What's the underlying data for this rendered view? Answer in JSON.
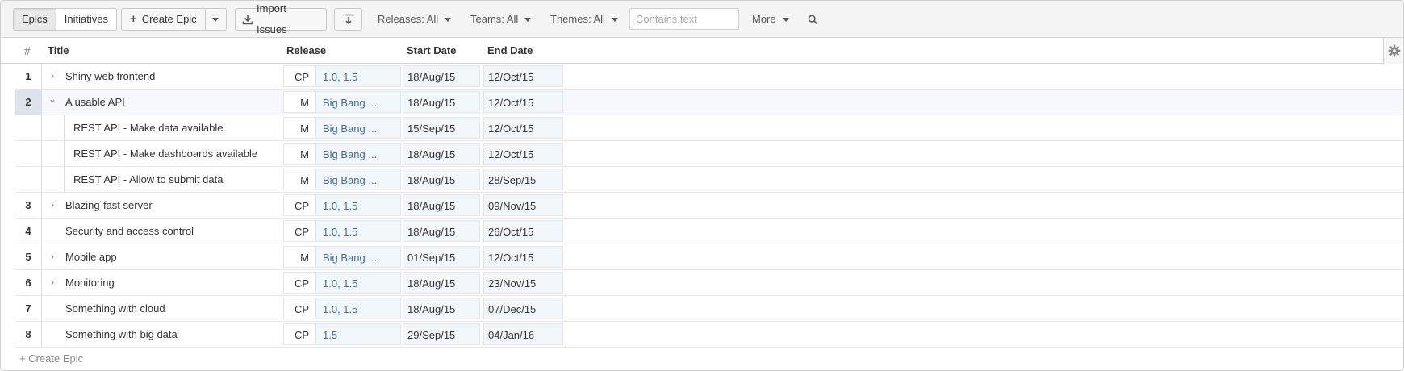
{
  "toolbar": {
    "view_tabs": [
      "Epics",
      "Initiatives"
    ],
    "create_label": "Create Epic",
    "import_label": "Import Issues",
    "filters": {
      "releases": "Releases: All",
      "teams": "Teams: All",
      "themes": "Themes: All"
    },
    "search_placeholder": "Contains text",
    "more_label": "More"
  },
  "columns": {
    "num": "#",
    "title": "Title",
    "release": "Release",
    "start": "Start Date",
    "end": "End Date"
  },
  "rows": [
    {
      "num": "1",
      "title": "Shiny web frontend",
      "code": "CP",
      "release": "1.0, 1.5",
      "start": "18/Aug/15",
      "end": "12/Oct/15",
      "chevron": "›"
    },
    {
      "num": "2",
      "title": "A usable API",
      "code": "M",
      "release": "Big Bang ...",
      "start": "18/Aug/15",
      "end": "12/Oct/15",
      "chevron": "⌄"
    },
    {
      "num": "",
      "title": "REST API - Make data available",
      "code": "M",
      "release": "Big Bang ...",
      "start": "15/Sep/15",
      "end": "12/Oct/15",
      "chevron": ""
    },
    {
      "num": "",
      "title": "REST API - Make dashboards available",
      "code": "M",
      "release": "Big Bang ...",
      "start": "18/Aug/15",
      "end": "12/Oct/15",
      "chevron": ""
    },
    {
      "num": "",
      "title": "REST API - Allow to submit data",
      "code": "M",
      "release": "Big Bang ...",
      "start": "18/Aug/15",
      "end": "28/Sep/15",
      "chevron": ""
    },
    {
      "num": "3",
      "title": "Blazing-fast server",
      "code": "CP",
      "release": "1.0, 1.5",
      "start": "18/Aug/15",
      "end": "09/Nov/15",
      "chevron": "›"
    },
    {
      "num": "4",
      "title": "Security and access control",
      "code": "CP",
      "release": "1.0, 1.5",
      "start": "18/Aug/15",
      "end": "26/Oct/15",
      "chevron": ""
    },
    {
      "num": "5",
      "title": "Mobile app",
      "code": "M",
      "release": "Big Bang ...",
      "start": "01/Sep/15",
      "end": "12/Oct/15",
      "chevron": "›"
    },
    {
      "num": "6",
      "title": "Monitoring",
      "code": "CP",
      "release": "1.0, 1.5",
      "start": "18/Aug/15",
      "end": "23/Nov/15",
      "chevron": "›"
    },
    {
      "num": "7",
      "title": "Something with cloud",
      "code": "CP",
      "release": "1.0, 1.5",
      "start": "18/Aug/15",
      "end": "07/Dec/15",
      "chevron": ""
    },
    {
      "num": "8",
      "title": "Something with big data",
      "code": "CP",
      "release": "1.5",
      "start": "29/Sep/15",
      "end": "04/Jan/16",
      "chevron": ""
    }
  ],
  "footer": {
    "create_link": "+ Create Epic"
  }
}
